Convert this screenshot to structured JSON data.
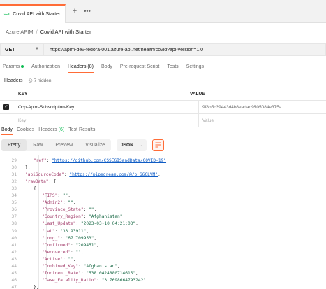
{
  "tab": {
    "method": "GET",
    "title": "Covid API with Starter",
    "add_icon": "plus-icon",
    "more_icon": "ellipsis-icon"
  },
  "breadcrumb": {
    "collection": "Azure APIM",
    "separator": "/",
    "current": "Covid API with Starter"
  },
  "request": {
    "method": "GET",
    "url": "https://apim-dev-fedora-001.azure-api.net/health/covid?api-version=1.0"
  },
  "request_tabs": [
    {
      "label": "Params"
    },
    {
      "label": "Authorization"
    },
    {
      "label": "Headers (8)"
    },
    {
      "label": "Body"
    },
    {
      "label": "Pre-request Script"
    },
    {
      "label": "Tests"
    },
    {
      "label": "Settings"
    }
  ],
  "headers_section": {
    "label": "Headers",
    "hidden": "7 hidden"
  },
  "headers_table": {
    "key_header": "KEY",
    "value_header": "VALUE",
    "rows": [
      {
        "key": "Ocp-Apim-Subscription-Key",
        "value": "9f8b5c39443d4b8eadad9505084e375a"
      }
    ],
    "placeholder_key": "Key",
    "placeholder_value": "Value"
  },
  "response_tabs": {
    "body": "Body",
    "cookies": "Cookies",
    "headers": "Headers",
    "headers_count": "(6)",
    "test_results": "Test Results"
  },
  "view_modes": {
    "pretty": "Pretty",
    "raw": "Raw",
    "preview": "Preview",
    "visualize": "Visualize"
  },
  "format": "JSON",
  "colors": {
    "accent": "#ff6c37",
    "get_green": "#0cbb52",
    "key": "#a33f6c",
    "string": "#1c6b48",
    "link": "#0f5cc4"
  },
  "code_lines": [
    {
      "n": "29",
      "indent": 2,
      "parts": [
        {
          "c": "k",
          "t": "\"ref\""
        },
        {
          "c": "p",
          "t": ": "
        },
        {
          "c": "u",
          "t": "\"https://github.com/CSSEGISandData/COVID-19\""
        }
      ]
    },
    {
      "n": "30",
      "indent": 1,
      "parts": [
        {
          "c": "p",
          "t": "},"
        }
      ]
    },
    {
      "n": "31",
      "indent": 1,
      "parts": [
        {
          "c": "k",
          "t": "\"apiSourceCode\""
        },
        {
          "c": "p",
          "t": ": "
        },
        {
          "c": "u",
          "t": "\"https://pipedream.com/@/p_G6CLVM\""
        },
        {
          "c": "p",
          "t": ","
        }
      ]
    },
    {
      "n": "32",
      "indent": 1,
      "parts": [
        {
          "c": "k",
          "t": "\"rawData\""
        },
        {
          "c": "p",
          "t": ": ["
        }
      ]
    },
    {
      "n": "33",
      "indent": 2,
      "parts": [
        {
          "c": "p",
          "t": "{"
        }
      ]
    },
    {
      "n": "34",
      "indent": 3,
      "parts": [
        {
          "c": "k",
          "t": "\"FIPS\""
        },
        {
          "c": "p",
          "t": ": "
        },
        {
          "c": "s",
          "t": "\"\""
        },
        {
          "c": "p",
          "t": ","
        }
      ]
    },
    {
      "n": "35",
      "indent": 3,
      "parts": [
        {
          "c": "k",
          "t": "\"Admin2\""
        },
        {
          "c": "p",
          "t": ": "
        },
        {
          "c": "s",
          "t": "\"\""
        },
        {
          "c": "p",
          "t": ","
        }
      ]
    },
    {
      "n": "36",
      "indent": 3,
      "parts": [
        {
          "c": "k",
          "t": "\"Province_State\""
        },
        {
          "c": "p",
          "t": ": "
        },
        {
          "c": "s",
          "t": "\"\""
        },
        {
          "c": "p",
          "t": ","
        }
      ]
    },
    {
      "n": "37",
      "indent": 3,
      "parts": [
        {
          "c": "k",
          "t": "\"Country_Region\""
        },
        {
          "c": "p",
          "t": ": "
        },
        {
          "c": "s",
          "t": "\"Afghanistan\""
        },
        {
          "c": "p",
          "t": ","
        }
      ]
    },
    {
      "n": "38",
      "indent": 3,
      "parts": [
        {
          "c": "k",
          "t": "\"Last_Update\""
        },
        {
          "c": "p",
          "t": ": "
        },
        {
          "c": "s",
          "t": "\"2023-03-10 04:21:03\""
        },
        {
          "c": "p",
          "t": ","
        }
      ]
    },
    {
      "n": "39",
      "indent": 3,
      "parts": [
        {
          "c": "k",
          "t": "\"Lat\""
        },
        {
          "c": "p",
          "t": ": "
        },
        {
          "c": "s",
          "t": "\"33.93911\""
        },
        {
          "c": "p",
          "t": ","
        }
      ]
    },
    {
      "n": "40",
      "indent": 3,
      "parts": [
        {
          "c": "k",
          "t": "\"Long_\""
        },
        {
          "c": "p",
          "t": ": "
        },
        {
          "c": "s",
          "t": "\"67.709953\""
        },
        {
          "c": "p",
          "t": ","
        }
      ]
    },
    {
      "n": "41",
      "indent": 3,
      "parts": [
        {
          "c": "k",
          "t": "\"Confirmed\""
        },
        {
          "c": "p",
          "t": ": "
        },
        {
          "c": "s",
          "t": "\"209451\""
        },
        {
          "c": "p",
          "t": ","
        }
      ]
    },
    {
      "n": "42",
      "indent": 3,
      "parts": [
        {
          "c": "k",
          "t": "\"Recovered\""
        },
        {
          "c": "p",
          "t": ": "
        },
        {
          "c": "s",
          "t": "\"\""
        },
        {
          "c": "p",
          "t": ","
        }
      ]
    },
    {
      "n": "43",
      "indent": 3,
      "parts": [
        {
          "c": "k",
          "t": "\"Active\""
        },
        {
          "c": "p",
          "t": ": "
        },
        {
          "c": "s",
          "t": "\"\""
        },
        {
          "c": "p",
          "t": ","
        }
      ]
    },
    {
      "n": "44",
      "indent": 3,
      "parts": [
        {
          "c": "k",
          "t": "\"Combined_Key\""
        },
        {
          "c": "p",
          "t": ": "
        },
        {
          "c": "s",
          "t": "\"Afghanistan\""
        },
        {
          "c": "p",
          "t": ","
        }
      ]
    },
    {
      "n": "45",
      "indent": 3,
      "parts": [
        {
          "c": "k",
          "t": "\"Incident_Rate\""
        },
        {
          "c": "p",
          "t": ": "
        },
        {
          "c": "s",
          "t": "\"538.0424880714615\""
        },
        {
          "c": "p",
          "t": ","
        }
      ]
    },
    {
      "n": "46",
      "indent": 3,
      "parts": [
        {
          "c": "k",
          "t": "\"Case_Fatality_Ratio\""
        },
        {
          "c": "p",
          "t": ": "
        },
        {
          "c": "s",
          "t": "\"3.7698664793242\""
        }
      ]
    },
    {
      "n": "47",
      "indent": 2,
      "parts": [
        {
          "c": "p",
          "t": "},"
        }
      ]
    }
  ]
}
